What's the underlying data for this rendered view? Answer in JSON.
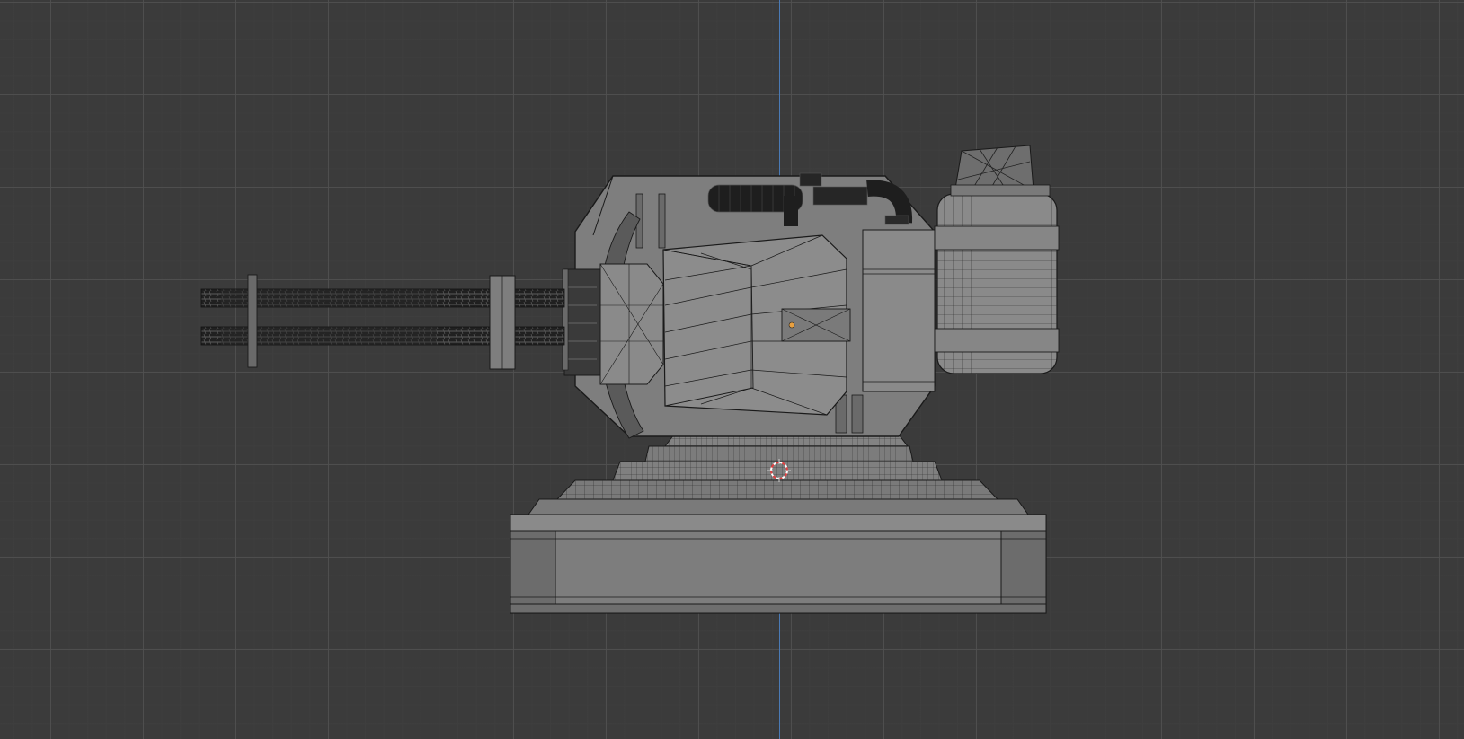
{
  "viewport": {
    "view": "orthographic-side",
    "grid": true,
    "colors": {
      "background": "#3b3b3b",
      "grid_major": "#505050",
      "grid_minor": "#3e3e3e",
      "x_axis": "#a04848",
      "z_axis": "#4a7ab5",
      "mesh_fill": "#7c7c7c",
      "mesh_wire": "#1a1a1a",
      "origin": "#e8a040",
      "cursor": "#e04040"
    },
    "icons": {
      "cursor": "3d-cursor-icon",
      "origin": "object-origin-icon"
    }
  }
}
